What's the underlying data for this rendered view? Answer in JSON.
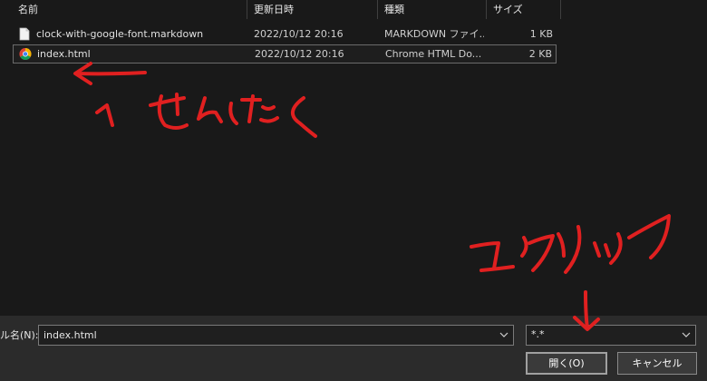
{
  "columns": {
    "name": "名前",
    "date": "更新日時",
    "type": "種類",
    "size": "サイズ"
  },
  "files": [
    {
      "name": "clock-with-google-font.markdown",
      "date": "2022/10/12 20:16",
      "type": "MARKDOWN ファイ...",
      "size": "1 KB",
      "icon": "document-icon"
    },
    {
      "name": "index.html",
      "date": "2022/10/12 20:16",
      "type": "Chrome HTML Do...",
      "size": "2 KB",
      "icon": "chrome-icon",
      "selected": true
    }
  ],
  "filename": {
    "label": "ル名(N):",
    "value": "index.html"
  },
  "filetype": {
    "value": "*.*"
  },
  "buttons": {
    "open": "開く(O)",
    "cancel": "キャンセル"
  },
  "colors": {
    "background": "#191919",
    "panel": "#2b2b2b",
    "annotation": "#e02020"
  }
}
